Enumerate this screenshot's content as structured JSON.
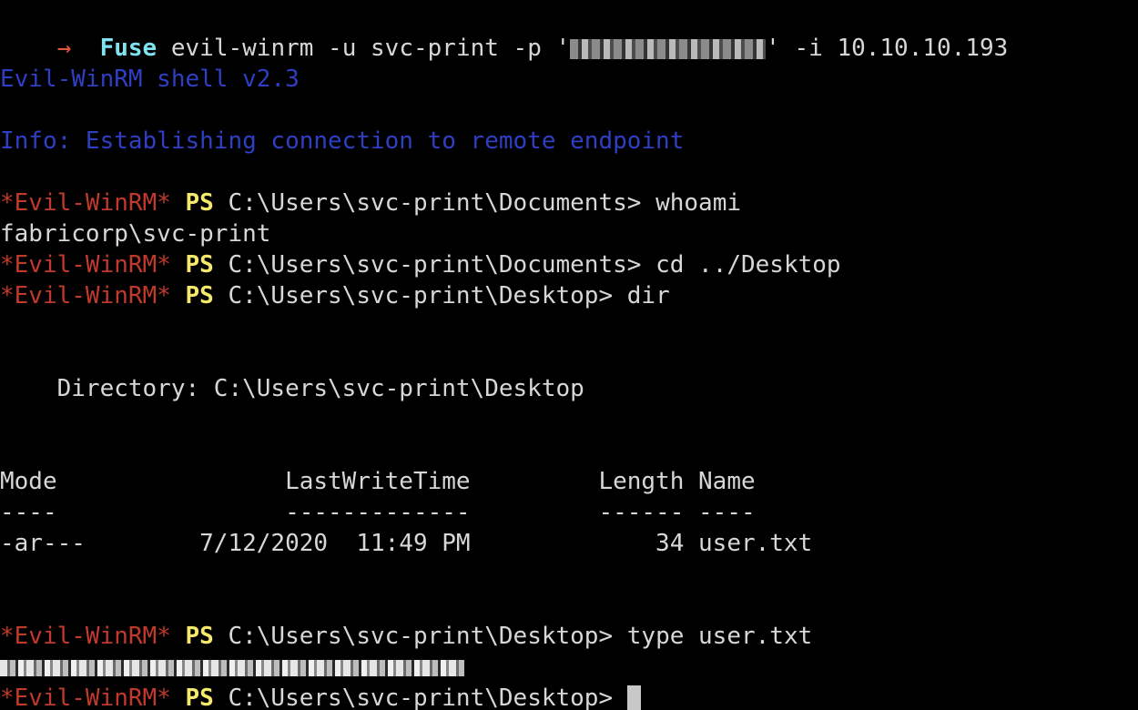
{
  "prompt": {
    "arrow": "→",
    "dir": "Fuse",
    "command_pre": "evil-winrm -u svc-print -p '",
    "command_post": "' -i 10.10.10.193"
  },
  "banner": {
    "shell_version": "Evil-WinRM shell v2.3",
    "info": "Info: Establishing connection to remote endpoint"
  },
  "ps_prompt": {
    "tag": "*Evil-WinRM*",
    "ps": "PS"
  },
  "session": [
    {
      "path": "C:\\Users\\svc-print\\Documents>",
      "cmd": " whoami"
    },
    {
      "output": "fabricorp\\svc-print"
    },
    {
      "path": "C:\\Users\\svc-print\\Documents>",
      "cmd": " cd ../Desktop"
    },
    {
      "path": "C:\\Users\\svc-print\\Desktop>",
      "cmd": " dir"
    }
  ],
  "directory": {
    "header": "    Directory: C:\\Users\\svc-print\\Desktop",
    "columns": "Mode                LastWriteTime         Length Name",
    "underline": "----                -------------         ------ ----",
    "rows": [
      "-ar---        7/12/2020  11:49 PM             34 user.txt"
    ]
  },
  "type_cmd": {
    "path": "C:\\Users\\svc-print\\Desktop>",
    "cmd": " type user.txt"
  },
  "final_prompt": {
    "path": "C:\\Users\\svc-print\\Desktop>",
    "cmd": " "
  },
  "colors": {
    "background": "#000000",
    "evil_tag": "#c0392b",
    "ps_label": "#f5e86a",
    "banner_blue": "#2e3fc4",
    "fuse_cyan": "#7fe3f0",
    "text": "#d7d7d7"
  }
}
